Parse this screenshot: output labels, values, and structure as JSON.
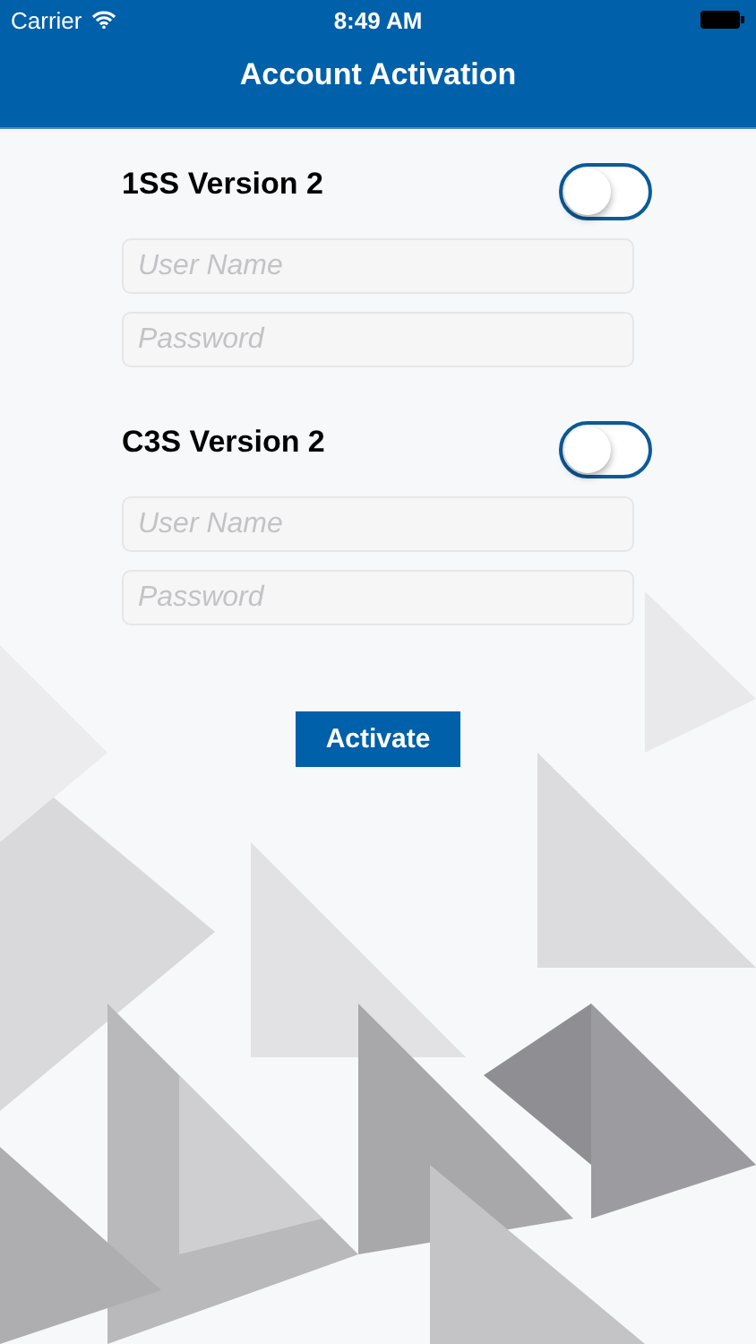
{
  "status_bar": {
    "carrier": "Carrier",
    "time": "8:49 AM"
  },
  "nav_bar": {
    "title": "Account Activation"
  },
  "sections": [
    {
      "title": "1SS Version 2",
      "on": false,
      "fields": [
        {
          "placeholder": "User Name"
        },
        {
          "placeholder": "Password"
        }
      ]
    },
    {
      "title": "C3S Version 2",
      "on": false,
      "fields": [
        {
          "placeholder": "User Name"
        },
        {
          "placeholder": "Password"
        }
      ]
    }
  ],
  "button": "Activate"
}
